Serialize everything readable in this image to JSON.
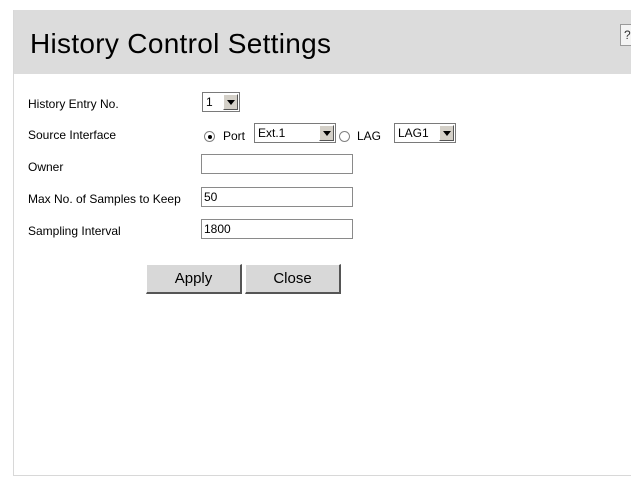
{
  "page": {
    "title": "History Control Settings",
    "help_label": "?"
  },
  "form": {
    "history_entry": {
      "label": "History Entry No.",
      "value": "1"
    },
    "source_interface": {
      "label": "Source Interface",
      "port_label": "Port",
      "port_value": "Ext.1",
      "lag_label": "LAG",
      "lag_value": "LAG1",
      "selected": "port"
    },
    "owner": {
      "label": "Owner",
      "value": ""
    },
    "max_samples": {
      "label": "Max No. of Samples to Keep",
      "value": "50"
    },
    "sampling_interval": {
      "label": "Sampling Interval",
      "value": "1800"
    }
  },
  "buttons": {
    "apply_label": "Apply",
    "close_label": "Close"
  }
}
